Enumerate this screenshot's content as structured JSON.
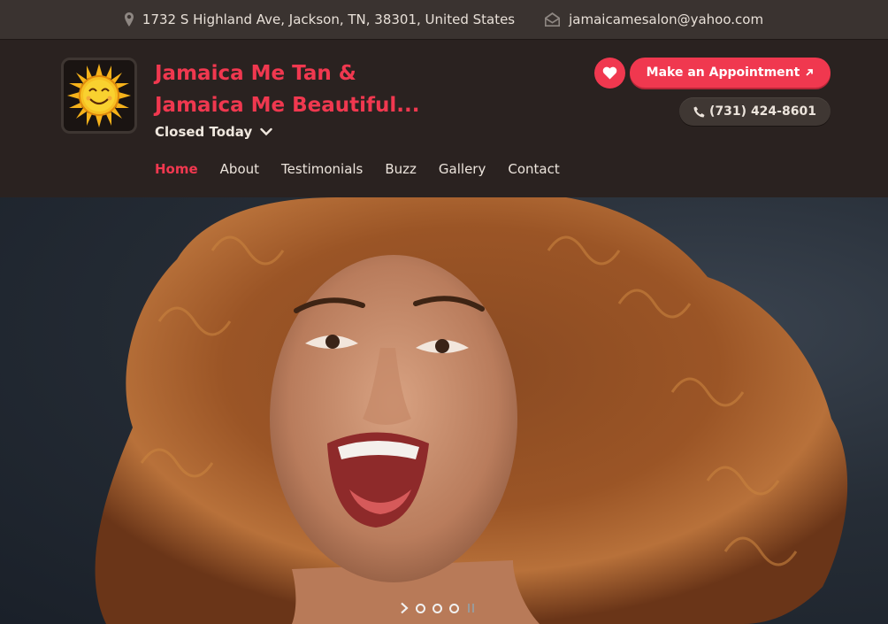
{
  "topbar": {
    "address": "1732 S Highland Ave, Jackson, TN, 38301, United States",
    "email": "jamaicamesalon@yahoo.com"
  },
  "brand": {
    "title_line1": "Jamaica Me Tan &",
    "title_line2": "Jamaica Me Beautiful...",
    "hours_status": "Closed Today"
  },
  "nav": {
    "items": [
      {
        "label": "Home",
        "active": true
      },
      {
        "label": "About"
      },
      {
        "label": "Testimonials"
      },
      {
        "label": "Buzz"
      },
      {
        "label": "Gallery"
      },
      {
        "label": "Contact"
      }
    ]
  },
  "actions": {
    "appointment_label": "Make an Appointment",
    "phone": "(731) 424-8601"
  },
  "slider": {
    "dots": 3
  },
  "colors": {
    "accent": "#f0384f",
    "header_bg": "#2a2220",
    "topbar_bg": "#3a3330"
  }
}
